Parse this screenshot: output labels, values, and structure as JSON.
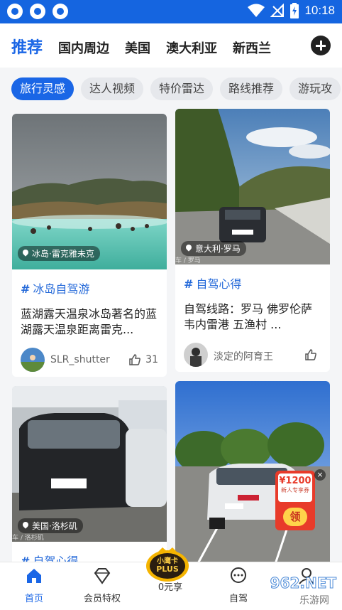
{
  "status_bar": {
    "time": "10:18"
  },
  "top_nav": {
    "tabs": [
      "推荐",
      "国内周边",
      "美国",
      "澳大利亚",
      "新西兰"
    ],
    "active_index": 0
  },
  "filters": {
    "chips": [
      "旅行灵感",
      "达人视频",
      "特价雷达",
      "路线推荐",
      "游玩攻"
    ],
    "active_index": 0
  },
  "cards": [
    {
      "location": "冰岛·雷克雅未克",
      "tag": "冰岛自驾游",
      "title": "蓝湖露天温泉冰岛著名的蓝湖露天温泉距离雷克...",
      "author": "SLR_shutter",
      "likes": "31"
    },
    {
      "location": "意大利·罗马",
      "credit": "车 / 罗马",
      "tag": "自驾心得",
      "title": "自驾线路：罗马 佛罗伦萨 韦内雷港 五渔村 ...",
      "author": "淡定的阿育王",
      "likes": ""
    },
    {
      "location": "美国·洛杉矶",
      "credit": "车 / 洛杉矶",
      "tag": "自驾心得"
    },
    {
      "location": ""
    }
  ],
  "coupon": {
    "amount": "¥1200",
    "subtitle": "新人专享券",
    "button": "领",
    "close": "×"
  },
  "plus_badge": {
    "line1": "小鹰卡",
    "line2": "PLUS"
  },
  "bottom_nav": {
    "items": [
      "首页",
      "会员特权",
      "0元享",
      "自驾",
      ""
    ],
    "active_index": 0
  },
  "watermark": {
    "brand": "962.NET",
    "sub": "乐游网"
  },
  "colors": {
    "accent": "#1a66e6",
    "status_bar": "#1565e0",
    "coupon": "#e83b2a"
  }
}
